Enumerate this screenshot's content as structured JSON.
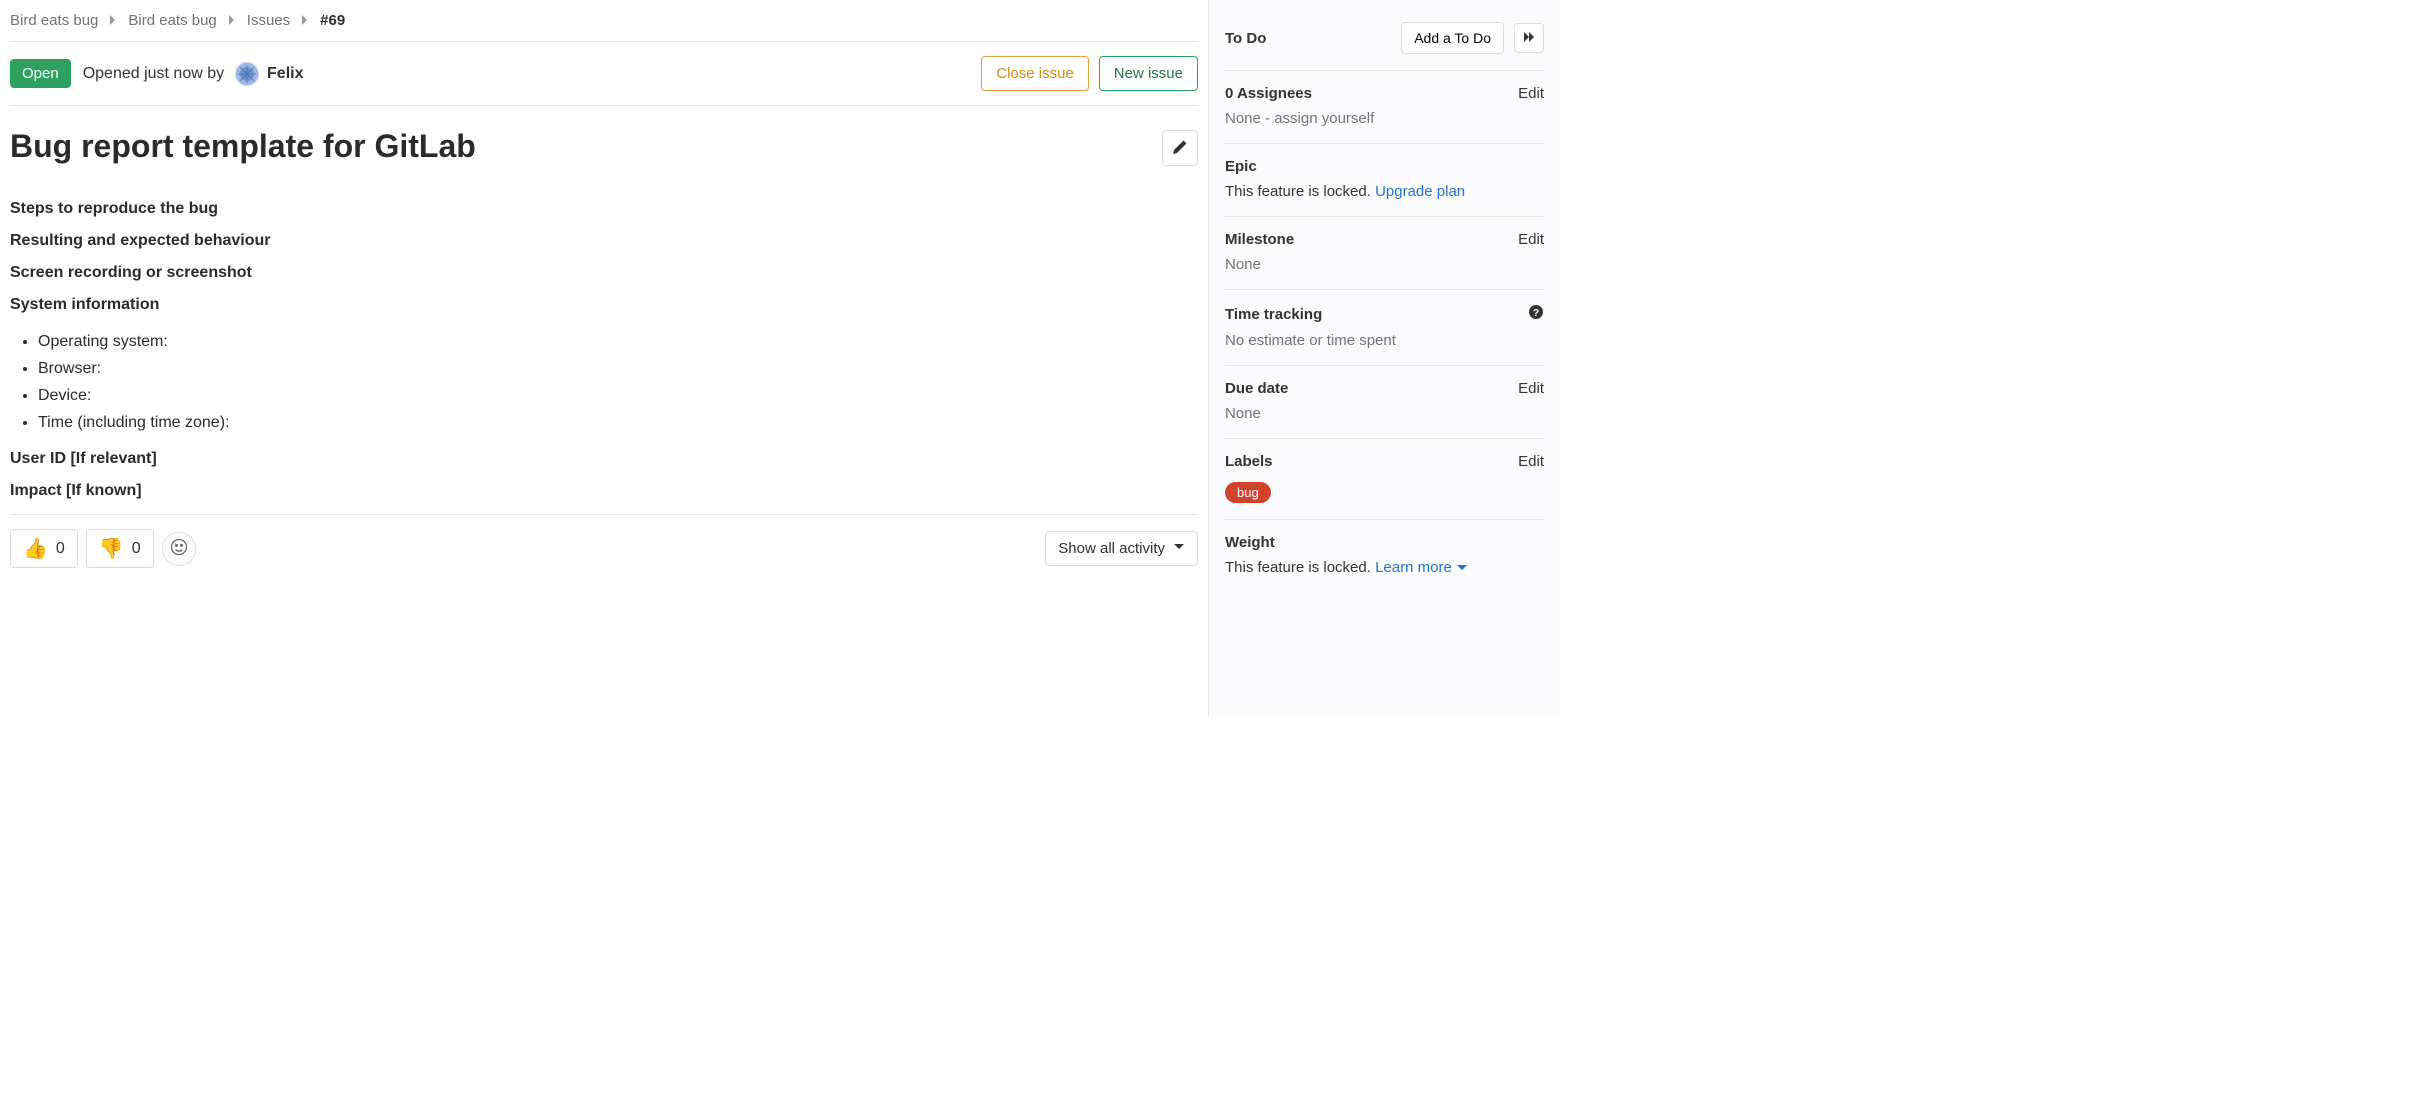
{
  "breadcrumb": {
    "root": "Bird eats bug",
    "group": "Bird eats bug",
    "section": "Issues",
    "current": "#69"
  },
  "header": {
    "status": "Open",
    "opened_prefix": "Opened just now by",
    "author": "Felix",
    "close_label": "Close issue",
    "new_label": "New issue"
  },
  "issue": {
    "title": "Bug report template for GitLab",
    "h_steps": "Steps to reproduce the bug",
    "h_expected": "Resulting and expected behaviour",
    "h_recording": "Screen recording or screenshot",
    "h_sysinfo": "System information",
    "sys_items": {
      "os": "Operating system:",
      "browser": "Browser:",
      "device": "Device:",
      "time": "Time (including time zone):"
    },
    "h_userid": "User ID [If relevant]",
    "h_impact": "Impact [If known]"
  },
  "reactions": {
    "thumbs_up_count": "0",
    "thumbs_down_count": "0"
  },
  "activity": {
    "filter_label": "Show all activity"
  },
  "sidebar": {
    "todo": {
      "title": "To Do",
      "button": "Add a To Do"
    },
    "assignees": {
      "title": "0 Assignees",
      "edit": "Edit",
      "none": "None - ",
      "assign_link": "assign yourself"
    },
    "epic": {
      "title": "Epic",
      "locked": "This feature is locked. ",
      "upgrade": "Upgrade plan"
    },
    "milestone": {
      "title": "Milestone",
      "edit": "Edit",
      "value": "None"
    },
    "time": {
      "title": "Time tracking",
      "value": "No estimate or time spent"
    },
    "due": {
      "title": "Due date",
      "edit": "Edit",
      "value": "None"
    },
    "labels": {
      "title": "Labels",
      "edit": "Edit",
      "chip": "bug"
    },
    "weight": {
      "title": "Weight",
      "locked": "This feature is locked. ",
      "learn": "Learn more"
    }
  }
}
